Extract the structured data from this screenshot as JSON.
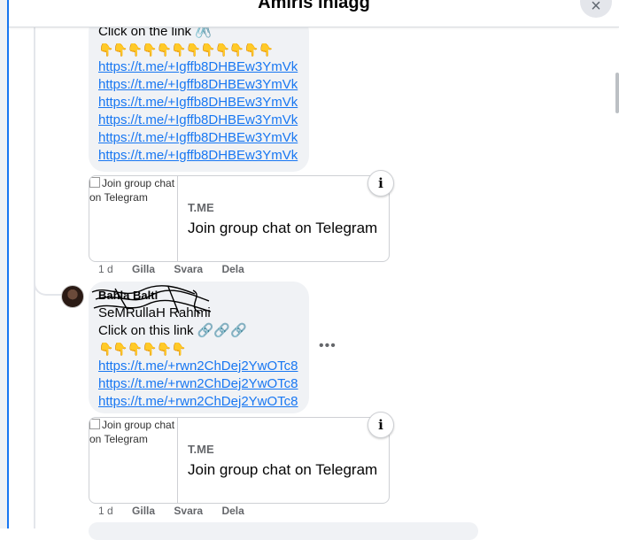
{
  "header": {
    "title": "Amiris inlägg",
    "close_icon": "×"
  },
  "comment1": {
    "lines": [
      "Click on the link 🖇️",
      "👇👇👇👇👇👇👇👇👇👇👇👇"
    ],
    "links": [
      "https://t.me/+Igffb8DHBEw3YmVk",
      "https://t.me/+Igffb8DHBEw3YmVk",
      "https://t.me/+Igffb8DHBEw3YmVk",
      "https://t.me/+Igffb8DHBEw3YmVk",
      "https://t.me/+Igffb8DHBEw3YmVk",
      "https://t.me/+Igffb8DHBEw3YmVk"
    ],
    "card": {
      "img_alt": "Join group chat on Telegram",
      "domain": "T.ME",
      "title": "Join group chat on Telegram"
    },
    "time": "1 d",
    "like": "Gilla",
    "reply": "Svara",
    "share": "Dela"
  },
  "comment2": {
    "name": "Bahla Balti",
    "subname": "SeMRullaH Rahimi",
    "lines": [
      "Click on this link 🔗🔗🔗",
      "👇👇👇👇👇👇"
    ],
    "links": [
      "https://t.me/+rwn2ChDej2YwOTc8",
      "https://t.me/+rwn2ChDej2YwOTc8",
      "https://t.me/+rwn2ChDej2YwOTc8"
    ],
    "card": {
      "img_alt": "Join group chat on Telegram",
      "domain": "T.ME",
      "title": "Join group chat on Telegram"
    },
    "time": "1 d",
    "like": "Gilla",
    "reply": "Svara",
    "share": "Dela",
    "more": "•••"
  },
  "info_icon": "i"
}
